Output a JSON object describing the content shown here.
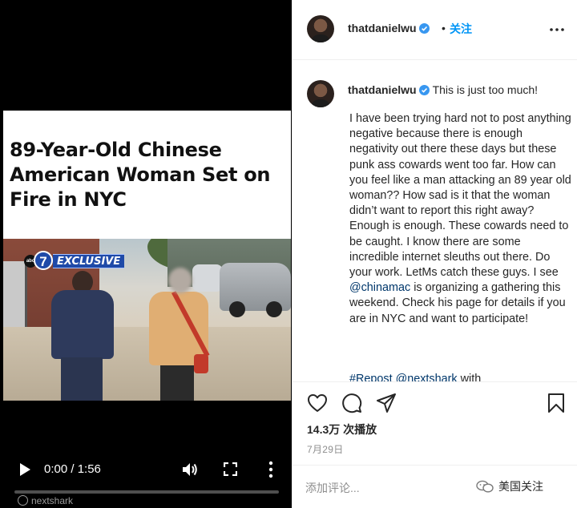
{
  "video": {
    "headline": "89-Year-Old Chinese American Woman Set on Fire in NYC",
    "station_logo_number": "7",
    "station_logo_text": "abc",
    "badge": "EXCLUSIVE",
    "time": "0:00 / 1:56",
    "progress_fraction": 0,
    "watermark": "nextshark"
  },
  "header": {
    "username": "thatdanielwu",
    "dot": "•",
    "follow_label": "关注",
    "more_icon": "more-horizontal-icon"
  },
  "caption": {
    "username": "thatdanielwu",
    "intro": "This is just too much!",
    "body_before": "I have been trying hard not to post anything negative because there is enough negativity out there these days but these punk ass cowards went too far. How can you feel like a man attacking an 89 year old woman?? How sad is it that the woman didn’t want to report this right away? Enough is enough. These cowards need to be caught. I know there are some incredible internet sleuths out there. Do your work. LetMs catch these guys. I see ",
    "mention": "@chinamac",
    "body_after": " is organizing a gathering this weekend. Check his page for details if you are in NYC and want to participate!",
    "hashtag_line": "#Repost @nextshark",
    "hashtag_tail": " with"
  },
  "actions": {
    "views": "14.3万 次播放",
    "date": "7月29日"
  },
  "comment": {
    "placeholder": "添加评论...",
    "watermark": "美国关注"
  },
  "colors": {
    "link": "#00376b",
    "follow": "#0095f6",
    "verified": "#3897f0",
    "badge_blue": "#1f4aa8"
  }
}
